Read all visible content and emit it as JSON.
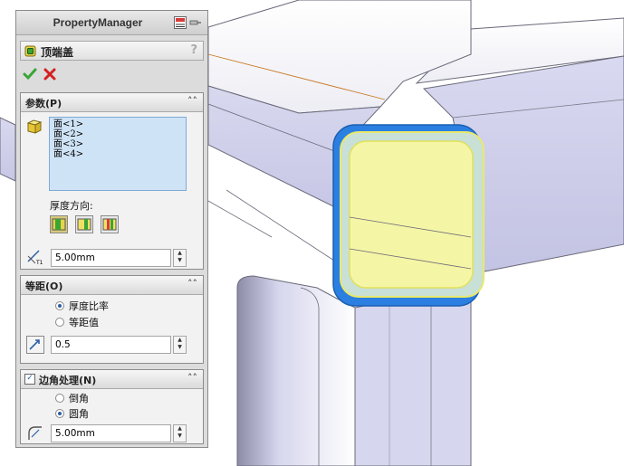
{
  "property_manager": {
    "title": "PropertyManager",
    "feature_name": "顶端盖",
    "help": "?"
  },
  "sections": {
    "parameters": {
      "title": "参数(P)",
      "faces": [
        "面<1>",
        "面<2>",
        "面<3>",
        "面<4>"
      ],
      "thickness_direction_label": "厚度方向:",
      "thickness": "5.00mm"
    },
    "offset": {
      "title": "等距(O)",
      "options": [
        "厚度比率",
        "等距值"
      ],
      "selected": 0,
      "ratio": "0.5"
    },
    "corner": {
      "title": "边角处理(N)",
      "checked": true,
      "options": [
        "倒角",
        "圆角"
      ],
      "selected": 1,
      "distance": "5.00mm"
    }
  },
  "colors": {
    "accent_blue": "#2b7fe0",
    "highlight_yellow": "#f5f5a6",
    "ok_green": "#3aa535",
    "cancel_red": "#d42020"
  },
  "icons": [
    "feature-icon",
    "ok-icon",
    "cancel-icon",
    "face-selection-icon",
    "thickness-icon",
    "offset-icon",
    "fillet-icon",
    "pin-icon",
    "collapse-icon"
  ]
}
